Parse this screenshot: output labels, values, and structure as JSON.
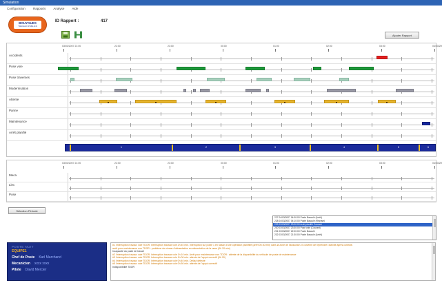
{
  "window": {
    "title": "Simulation"
  },
  "menu": [
    "Configuration",
    "Rapports",
    "Analyse",
    "Aide"
  ],
  "logo": {
    "line1": "BOUYGUES",
    "line2": "TRAVAUX PUBLICS"
  },
  "header": {
    "report_label": "ID Rapport :",
    "report_value": "417",
    "report_button": "Ajouter Rapport"
  },
  "icons": {
    "save": "save-icon",
    "network": "network-icon"
  },
  "gantt_top": {
    "time_ticks": [
      {
        "date": "03/03/2007",
        "time": "21:00"
      },
      {
        "date": "",
        "time": "22:00"
      },
      {
        "date": "",
        "time": "23:00"
      },
      {
        "date": "",
        "time": "00:00"
      },
      {
        "date": "",
        "time": "01:00"
      },
      {
        "date": "",
        "time": "02:00"
      },
      {
        "date": "",
        "time": "03:00"
      },
      {
        "date": "04/03/2007",
        "time": "04:00"
      }
    ],
    "rows": [
      {
        "key": "accidents",
        "label": "Accidents"
      },
      {
        "key": "pose",
        "label": "Pose voie"
      },
      {
        "key": "pose_traverse",
        "label": "Pose traverses"
      },
      {
        "key": "modernisation",
        "label": "Modernisation"
      },
      {
        "key": "attente",
        "label": "Attente"
      },
      {
        "key": "panne",
        "label": "Panne"
      },
      {
        "key": "maintenance",
        "label": "Maintenance"
      },
      {
        "key": "arret_planifie",
        "label": "Arrêt planifié"
      }
    ],
    "strip_labels": [
      "1",
      "2",
      "3",
      "4",
      "5",
      "6"
    ]
  },
  "gantt_bottom": {
    "time_ticks": [
      {
        "date": "03/03/2007",
        "time": "21:00"
      },
      {
        "date": "",
        "time": "22:00"
      },
      {
        "date": "",
        "time": "23:00"
      },
      {
        "date": "",
        "time": "00:00"
      },
      {
        "date": "",
        "time": "01:00"
      },
      {
        "date": "",
        "time": "02:00"
      },
      {
        "date": "",
        "time": "03:00"
      },
      {
        "date": "04/03/2007",
        "time": "04:00"
      }
    ],
    "rows": [
      {
        "key": "meca",
        "label": "Meca"
      },
      {
        "key": "liec",
        "label": "Liec"
      },
      {
        "key": "pose",
        "label": "Pose"
      }
    ]
  },
  "buttons": {
    "select_period": "Sélection Période"
  },
  "event_list": [
    {
      "text": "227  04/03/2007 04:00:00  Poste Basculé (Arrêt)",
      "selected": false
    },
    {
      "text": "228  04/03/2007 04:10:00  Poste Basculé (Reprise)",
      "selected": false
    },
    {
      "text": "229  03/03/2007 23:00:00  Arrêt planifié Courant",
      "selected": true
    },
    {
      "text": "230  03/03/2007 23:30:00  Pose voie (Courant)",
      "selected": false
    },
    {
      "text": "231  03/03/2007 22:00:00  Poste Basculé",
      "selected": false
    },
    {
      "text": "232  03/03/2007 21:30:00  Poste Basculé (Arrêt)",
      "selected": false
    }
  ],
  "crew": {
    "title": "POSTE NUIT",
    "team_label": "EQUIPE1",
    "members": [
      {
        "role": "Chef de Poste",
        "name": "Karl  Marchand"
      },
      {
        "role": "Mecanicien",
        "name": "xxxx  xxxx"
      },
      {
        "role": "Pilote",
        "name": "David  Mercier"
      }
    ]
  },
  "log_lines": [
    {
      "text": "#1 /Interruption travaux voie TDOR. Interruption travaux voie 2h 40 min.  Interruption sur poste 1 en raison d'une opération planifiée (arrêt 0h 30 min) dans la zone de l'adduction. Il convient de reprendre l'activité après contrôle.",
      "color": "#d07800"
    },
    {
      "text": "arrêt pour maintenance non TDOR : problème de niveau d'alimentation en alimentation de la rame (0h 20 min)",
      "color": "#d07800"
    },
    {
      "text": "Incapacité du poste de travail",
      "color": "#333333"
    },
    {
      "text": "#2 /Interruption travaux voie TDOR. Interruption travaux voie 1h 10 min.  Arrêt pour maintenance non TDOR : attente de la disponibilité du véhicule de poste de maintenance",
      "color": "#d07800"
    },
    {
      "text": "#3 /Interruption travaux voie TDOR. Interruption travaux voie 1h 00 min.  attente de l'appui correctif (0h 20)",
      "color": "#d07800"
    },
    {
      "text": "#4 /Interruption travaux voie TDOR. Interruption travaux voie 0h 40 min.  Défaut détecté",
      "color": "#d07800"
    },
    {
      "text": "#5 /Interruption travaux voie TDOR. Interruption travaux voie 0h 50 min.  attente de l'appui correctif",
      "color": "#d07800"
    },
    {
      "text": "Indisponibilité TDOR",
      "color": "#333333"
    }
  ],
  "colors": {
    "titlebar": "#2d64b4",
    "green": "#1f9a3b",
    "mint": "#a8d0bd",
    "grey": "#9a9aa6",
    "amber": "#e8b62e",
    "red": "#e32020",
    "blue": "#1528a0",
    "crew_bg": "#1b2e86"
  }
}
